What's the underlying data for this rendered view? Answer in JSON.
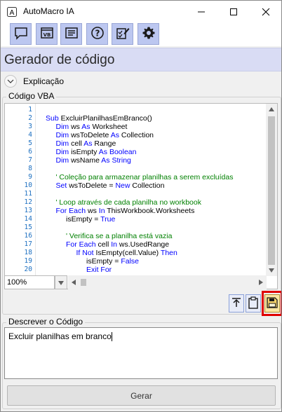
{
  "window": {
    "title": "AutoMacro IA"
  },
  "toolbar": {
    "buttons": [
      {
        "icon": "chat-icon"
      },
      {
        "icon": "vb-icon"
      },
      {
        "icon": "document-list-icon"
      },
      {
        "icon": "help-icon"
      },
      {
        "icon": "checklist-edit-icon"
      },
      {
        "icon": "gear-icon"
      }
    ]
  },
  "header": {
    "title": "Gerador de código"
  },
  "explanation": {
    "label": "Explicação"
  },
  "code_group": {
    "label": "Código VBA"
  },
  "code": {
    "line_numbers": [
      "1",
      "2",
      "3",
      "4",
      "5",
      "6",
      "7",
      "8",
      "9",
      "10",
      "11",
      "12",
      "13",
      "14",
      "15",
      "16",
      "17",
      "18",
      "19",
      "20"
    ],
    "zoom": "100%"
  },
  "describe": {
    "label": "Descrever o Código",
    "value": "Excluir planilhas em branco"
  },
  "generate_button": {
    "label": "Gerar"
  },
  "colors": {
    "keyword": "#0000ff",
    "comment": "#008000",
    "line_number": "#1c6fc0",
    "toolbar_button": "#bcc7f0",
    "header_bg": "#d9dcf4",
    "highlight": "#e00000"
  }
}
